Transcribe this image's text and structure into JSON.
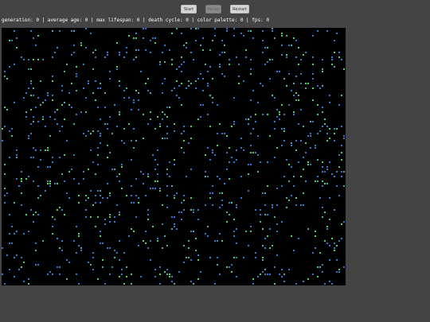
{
  "controls": {
    "start_label": "Start",
    "pause_label": "Pause",
    "restart_label": "Restart"
  },
  "status": {
    "text": "generation: 0 | average age: 0 | max lifespan: 0 | death cycle: 0 | color palette: 0 | fps: 0"
  },
  "simulation": {
    "background": "#000000",
    "cell_colors": [
      "#3a78d0",
      "#4fd46a",
      "#5aa6a6"
    ]
  }
}
